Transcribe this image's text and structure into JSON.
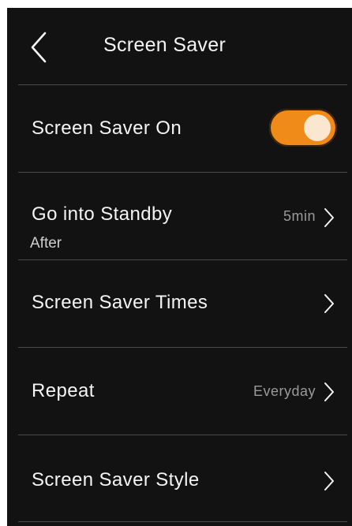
{
  "header": {
    "title": "Screen Saver",
    "back_icon": "chevron-left-icon"
  },
  "rows": [
    {
      "label": "Screen Saver On",
      "toggle_on": true,
      "accent": "#f08a18"
    },
    {
      "label": "Go into Standby",
      "sublabel": "After",
      "value": "5min"
    },
    {
      "label": "Screen Saver Times"
    },
    {
      "label": "Repeat",
      "value": "Everyday"
    },
    {
      "label": "Screen Saver Style"
    }
  ],
  "colors": {
    "background": "#121212",
    "text": "#f4f4f4",
    "value_text": "#9a9a9a",
    "divider": "#4a4a4a",
    "toggle_on": "#f08a18"
  }
}
